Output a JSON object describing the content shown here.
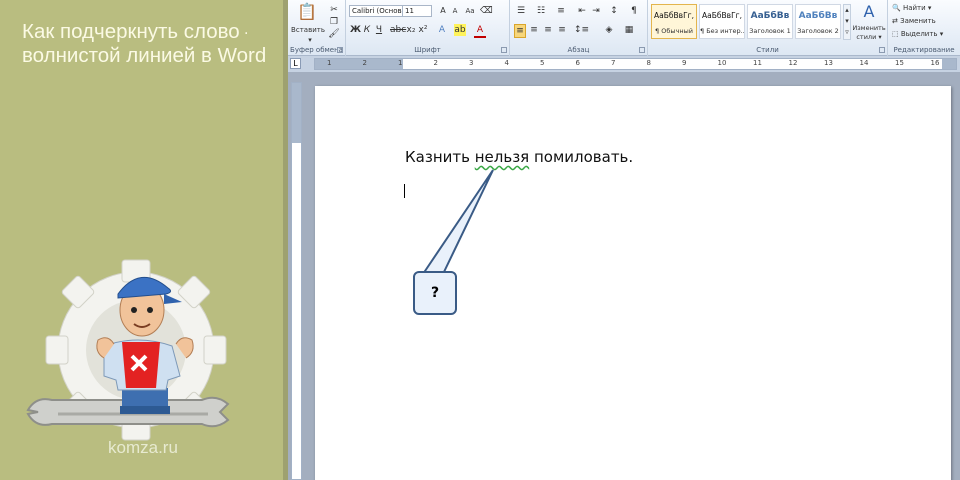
{
  "banner": {
    "title_line1": "Как подчеркнуть слово",
    "title_line2": "волнистой линией в Word",
    "site": "komza.ru"
  },
  "ribbon": {
    "clipboard": {
      "paste_label": "Вставить",
      "group_label": "Буфер обмена"
    },
    "font": {
      "font_name": "Calibri (Основ",
      "font_size": "11",
      "group_label": "Шрифт"
    },
    "paragraph": {
      "group_label": "Абзац"
    },
    "styles": {
      "group_label": "Стили",
      "items": [
        {
          "sample": "АаБбВвГг,",
          "name": "¶ Обычный"
        },
        {
          "sample": "АаБбВвГг,",
          "name": "¶ Без интер..."
        },
        {
          "sample": "АаБбВв",
          "name": "Заголовок 1"
        },
        {
          "sample": "АаБбВв",
          "name": "Заголовок 2"
        }
      ],
      "change_styles_line1": "Изменить",
      "change_styles_line2": "стили"
    },
    "editing": {
      "group_label": "Редактирование",
      "find": "Найти",
      "replace": "Заменить",
      "select": "Выделить"
    }
  },
  "ruler": {
    "numbers": [
      "1",
      "2",
      "1",
      "2",
      "3",
      "4",
      "5",
      "6",
      "7",
      "8",
      "9",
      "10",
      "11",
      "12",
      "13",
      "14",
      "15",
      "16",
      "17"
    ]
  },
  "document": {
    "word_before": "Казнить ",
    "misspelled_word": "нельзя",
    "word_after": " помиловать.",
    "callout_text": "?"
  },
  "colors": {
    "banner_bg": "#b9bd80",
    "squiggle": "#3aa845",
    "callout_border": "#3a5b86"
  }
}
